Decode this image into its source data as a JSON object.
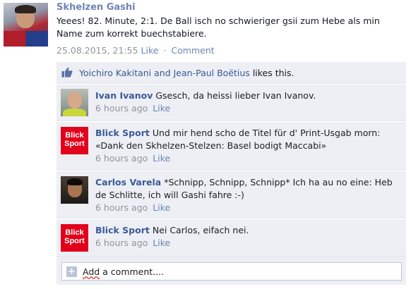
{
  "post": {
    "author": "Skhelzen Gashi",
    "text": "Yeees! 82. Minute, 2:1. De Ball isch no schwieriger gsii zum Hebe als min Name zum korrekt buechstabiere.",
    "timestamp": "25.08.2015, 21:55",
    "like_label": "Like",
    "separator": "·",
    "comment_label": "Comment"
  },
  "likes": {
    "names": "Yoichiro Kakitani and Jean-Paul Boëtius",
    "suffix": "likes this."
  },
  "comments": [
    {
      "author": "Ivan Ivanov",
      "text": "Gsesch, da heissi lieber Ivan Ivanov.",
      "time": "6 hours ago",
      "like_label": "Like"
    },
    {
      "author": "Blick Sport",
      "text": "Und mir hend scho de Titel für d' Print-Usgab morn: «Dank den Skhelzen-Stelzen: Basel bodigt Maccabi»",
      "time": "6 hours ago",
      "like_label": "Like",
      "logo_line1": "Blick",
      "logo_line2": "Sport"
    },
    {
      "author": "Carlos Varela",
      "text": "*Schnipp, Schnipp, Schnipp* Ich ha au no eine: Heb de Schlitte, ich will Gashi fahre :-)",
      "time": "6 hours ago",
      "like_label": "Like"
    },
    {
      "author": "Blick Sport",
      "text": "Nei Carlos, eifach nei.",
      "time": "6 hours ago",
      "like_label": "Like",
      "logo_line1": "Blick",
      "logo_line2": "Sport"
    }
  ],
  "add_comment": {
    "icon": "+",
    "placeholder_word": "Add",
    "placeholder_rest": " a comment...."
  },
  "colors": {
    "link": "#3b5998",
    "muted_link": "#6d84b4",
    "panel_bg": "#edeff4",
    "blick_red": "#e2001a"
  },
  "icons": [
    "thumbs-up-icon",
    "plus-icon"
  ]
}
